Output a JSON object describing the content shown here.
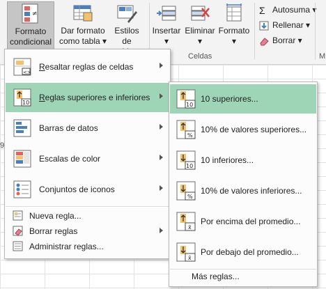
{
  "ribbon": {
    "styles_buttons": [
      {
        "line1": "Formato",
        "line2": "condicional",
        "name": "conditional-formatting-button"
      },
      {
        "line1": "Dar formato",
        "line2": "como tabla",
        "name": "format-as-table-button"
      },
      {
        "line1": "Estilos de",
        "line2": "celda",
        "name": "cell-styles-button"
      }
    ],
    "cells_buttons": [
      {
        "label": "Insertar",
        "name": "insert-button"
      },
      {
        "label": "Eliminar",
        "name": "delete-button"
      },
      {
        "label": "Formato",
        "name": "format-button"
      }
    ],
    "cells_group_label": "Celdas",
    "editing": {
      "autosum": "Autosuma",
      "fill": "Rellenar",
      "clear": "Borrar"
    },
    "clipped_group_initial": "M"
  },
  "menu": {
    "items": [
      {
        "label": "Resaltar reglas de celdas",
        "underline_char": "R",
        "rest": "esaltar reglas de celdas"
      },
      {
        "label": "Reglas superiores e inferiores",
        "underline_char": "R",
        "rest": "eglas superiores e inferiores"
      },
      {
        "label": "Barras de datos",
        "underline_char": "",
        "rest": "Barras de datos"
      },
      {
        "label": "Escalas de color",
        "underline_char": "",
        "rest": "Escalas de color"
      },
      {
        "label": "Conjuntos de iconos",
        "underline_char": "",
        "rest": "Conjuntos de iconos"
      }
    ],
    "small_items": [
      "Nueva regla...",
      "Borrar reglas",
      "Administrar reglas..."
    ]
  },
  "submenu": {
    "items": [
      "10 superiores...",
      "10% de valores superiores...",
      "10 inferiores...",
      "10% de valores inferiores...",
      "Por encima del promedio...",
      "Por debajo del promedio..."
    ],
    "more": "Más reglas..."
  },
  "sheet": {
    "partial_row_header": "9"
  },
  "colors": {
    "highlight": "#9fd5b7",
    "ribbon_bg": "#f3f3f3",
    "active_button": "#c5c5c5"
  }
}
